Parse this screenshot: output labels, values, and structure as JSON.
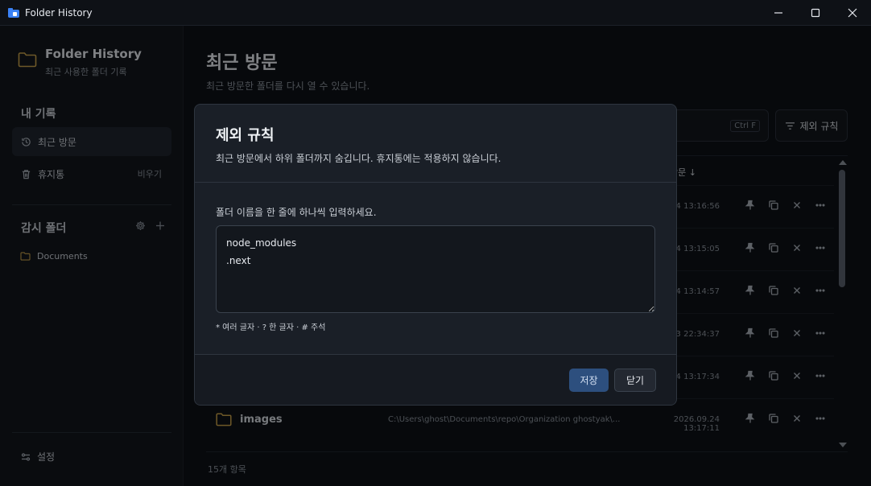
{
  "window": {
    "title": "Folder History"
  },
  "sidebar": {
    "brand_title": "Folder History",
    "brand_subtitle": "최근 사용한 폴더 기록",
    "my_records_label": "내 기록",
    "recent_label": "최근 방문",
    "trash_label": "휴지통",
    "trash_action": "비우기",
    "watch_label": "감시 폴더",
    "watch_folders": [
      "Documents"
    ],
    "settings_label": "설정"
  },
  "main": {
    "title": "최근 방문",
    "subtitle": "최근 방문한 폴더를 다시 열 수 있습니다.",
    "search_shortcut": "Ctrl F",
    "exclude_button": "제외 규칙",
    "column_visit": "방문 ↓",
    "rows": [
      {
        "name": "",
        "path": "",
        "time": "4 13:16:56"
      },
      {
        "name": "",
        "path": "",
        "time": "4 13:15:05"
      },
      {
        "name": "",
        "path": "",
        "time": "4 13:14:57"
      },
      {
        "name": "",
        "path": "",
        "time": "3 22:34:37"
      },
      {
        "name": "",
        "path": "",
        "time": "4 13:17:34"
      },
      {
        "name": "images",
        "path": "C:\\Users\\ghost\\Documents\\repo\\Organization ghostyak\\...",
        "time": "2026.09.24 13:17:11"
      }
    ],
    "footer_count": "15개 항목"
  },
  "dialog": {
    "title": "제외 규칙",
    "description": "최근 방문에서 하위 폴더까지 숨깁니다. 휴지통에는 적용하지 않습니다.",
    "label": "폴더 이름을 한 줄에 하나씩 입력하세요.",
    "textarea_value": "node_modules\n.next",
    "hint": "* 여러 글자 · ? 한 글자 · # 주석",
    "save_button": "저장",
    "close_button": "닫기"
  },
  "colors": {
    "accent": "#2d4f7e",
    "folder": "#c9a24a"
  }
}
